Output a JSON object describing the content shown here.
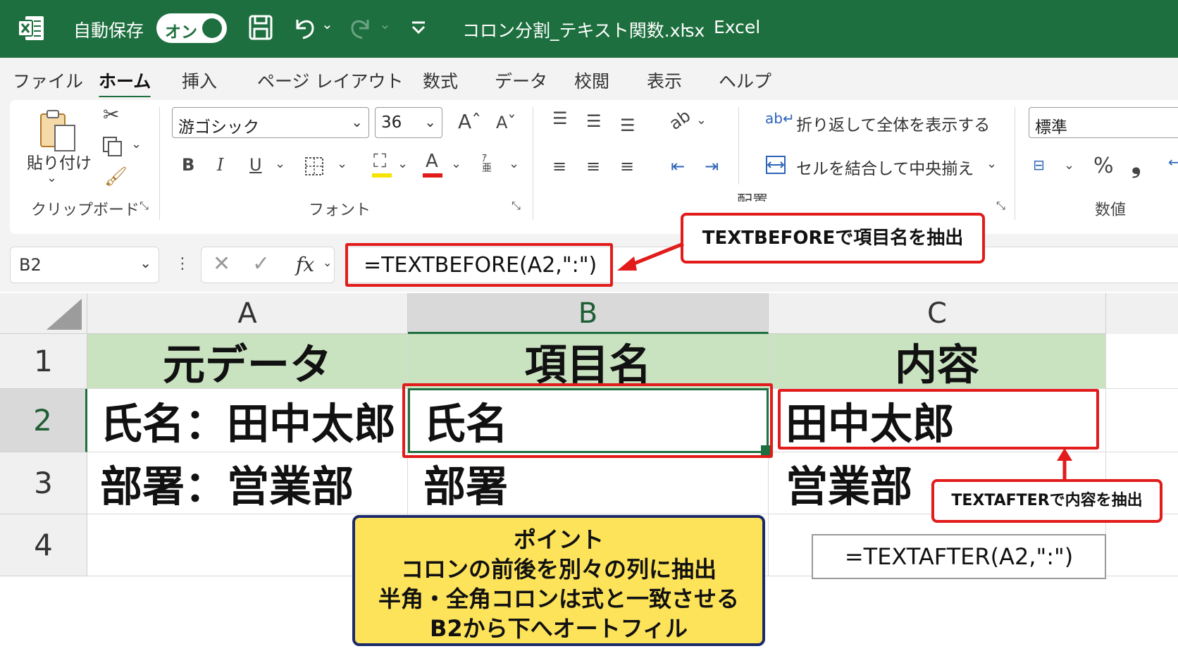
{
  "titlebar": {
    "autosave_label": "自動保存",
    "autosave_state": "オン",
    "filename": "コロン分割_テキスト関数.xlsx",
    "separator": "-",
    "app_name": "Excel"
  },
  "tabs": [
    {
      "label": "ファイル"
    },
    {
      "label": "ホーム",
      "active": true
    },
    {
      "label": "挿入"
    },
    {
      "label": "ページ レイアウト"
    },
    {
      "label": "数式"
    },
    {
      "label": "データ"
    },
    {
      "label": "校閲"
    },
    {
      "label": "表示"
    },
    {
      "label": "ヘルプ"
    }
  ],
  "ribbon": {
    "clipboard": {
      "paste_label": "貼り付け",
      "group_label": "クリップボード"
    },
    "font": {
      "font_name": "游ゴシック",
      "font_size": "36",
      "group_label": "フォント"
    },
    "alignment": {
      "wrap_text": "折り返して全体を表示する",
      "merge_center": "セルを結合して中央揃え",
      "group_label_partial": "配置"
    },
    "number": {
      "format": "標準",
      "group_label": "数値",
      "percent": "%",
      "comma": "❟"
    }
  },
  "formula_bar": {
    "name_box": "B2",
    "fx": "fx",
    "formula": "=TEXTBEFORE(A2,\":\")"
  },
  "grid": {
    "columns": [
      "A",
      "B",
      "C"
    ],
    "rows": [
      "1",
      "2",
      "3",
      "4"
    ],
    "cells": {
      "A1": "元データ",
      "B1": "項目名",
      "C1": "内容",
      "A2": "氏名：田中太郎",
      "B2": "氏名",
      "C2": "田中太郎",
      "A3": "部署：営業部",
      "B3": "部署",
      "C3": "営業部"
    }
  },
  "annotations": {
    "textbefore_callout": "TEXTBEFOREで項目名を抽出",
    "textafter_callout": "TEXTAFTERで内容を抽出",
    "textafter_formula": "=TEXTAFTER(A2,\":\")",
    "point_box": {
      "title": "ポイント",
      "lines": [
        "コロンの前後を別々の列に抽出",
        "半角・全角コロンは式と一致させる",
        "B2から下へオートフィル"
      ]
    }
  },
  "colors": {
    "excel_green": "#1e6f3f",
    "header_fill": "#c9e2c0",
    "highlight_red": "#e21b1b",
    "note_yellow": "#fde35a"
  }
}
